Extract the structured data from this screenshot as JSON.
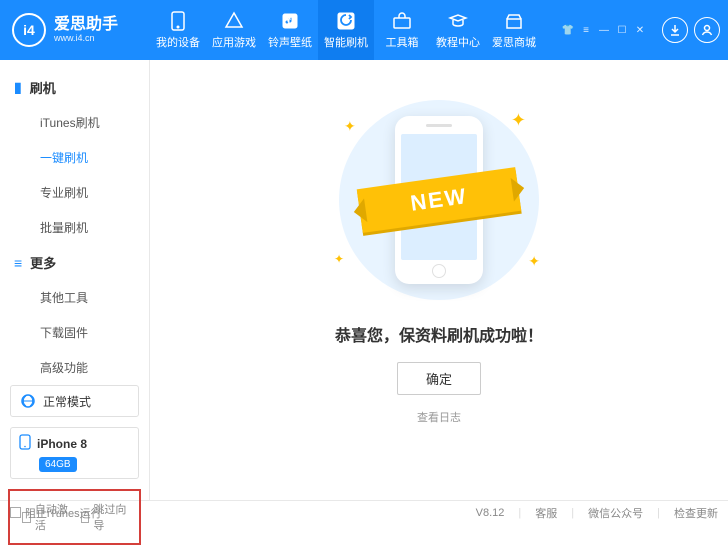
{
  "brand": {
    "logo_text": "i4",
    "name": "爱思助手",
    "url": "www.i4.cn"
  },
  "top_tabs": [
    {
      "label": "我的设备"
    },
    {
      "label": "应用游戏"
    },
    {
      "label": "铃声壁纸"
    },
    {
      "label": "智能刷机",
      "active": true
    },
    {
      "label": "工具箱"
    },
    {
      "label": "教程中心"
    },
    {
      "label": "爱思商城"
    }
  ],
  "sidebar": {
    "group1": {
      "title": "刷机",
      "items": [
        "iTunes刷机",
        "一键刷机",
        "专业刷机",
        "批量刷机"
      ],
      "active_index": 1
    },
    "group2": {
      "title": "更多",
      "items": [
        "其他工具",
        "下载固件",
        "高级功能"
      ]
    }
  },
  "mode_box": {
    "label": "正常模式"
  },
  "device_box": {
    "name": "iPhone 8",
    "storage": "64GB"
  },
  "bottom_checks": {
    "auto_activate": "自动激活",
    "skip_guide": "跳过向导"
  },
  "main": {
    "ribbon": "NEW",
    "message": "恭喜您，保资料刷机成功啦！",
    "ok_button": "确定",
    "log_link": "查看日志"
  },
  "footer": {
    "block_itunes": "阻止iTunes运行",
    "version": "V8.12",
    "support": "客服",
    "wechat": "微信公众号",
    "update": "检查更新"
  }
}
